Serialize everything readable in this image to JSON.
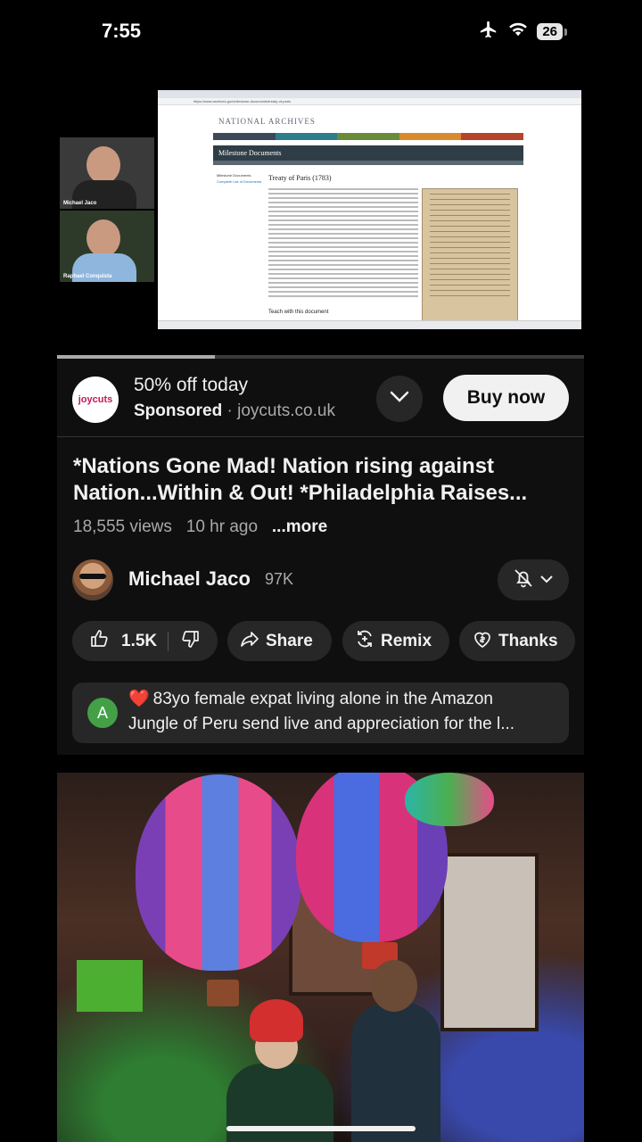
{
  "status_bar": {
    "time": "7:55",
    "battery": "26"
  },
  "video_frame": {
    "participants": [
      "Michael Jaco",
      "Raphael Conquista"
    ],
    "browser": {
      "url": "https://www.archives.gov/milestone-documents/treaty-of-paris",
      "site_logo": "NATIONAL ARCHIVES",
      "section_title": "Milestone Documents",
      "side_menu": [
        "Milestone Documents",
        "Complete List of Documents"
      ],
      "page_heading": "Treaty of Paris (1783)",
      "teach_label": "Teach with this document"
    },
    "progress_fraction": 0.3
  },
  "ad": {
    "logo_text": "joycuts",
    "headline": "50% off today",
    "sponsored_label": "Sponsored",
    "separator": " · ",
    "domain": "joycuts.co.uk",
    "cta": "Buy now"
  },
  "video": {
    "title": "*Nations Gone Mad! Nation rising against Nation...Within & Out! *Philadelphia Raises...",
    "views": "18,555 views",
    "age": "10 hr ago",
    "more": "...more"
  },
  "channel": {
    "name": "Michael Jaco",
    "subscribers": "97K"
  },
  "actions": {
    "likes": "1.5K",
    "share": "Share",
    "remix": "Remix",
    "thanks": "Thanks"
  },
  "comment": {
    "avatar_letter": "A",
    "line1": "83yo female expat living alone in the Amazon",
    "line2": "Jungle of Peru send live and appreciation for the l..."
  },
  "colors": {
    "background": "#0f0f0f",
    "pill": "#272727",
    "text_primary": "#f1f1f1",
    "text_secondary": "#aaaaaa",
    "comment_avatar": "#43a047"
  },
  "icons": [
    "airplane-icon",
    "wifi-icon",
    "chevron-down-icon",
    "bell-off-icon",
    "thumb-up-icon",
    "thumb-down-icon",
    "share-icon",
    "remix-icon",
    "thanks-icon",
    "heart-icon"
  ]
}
